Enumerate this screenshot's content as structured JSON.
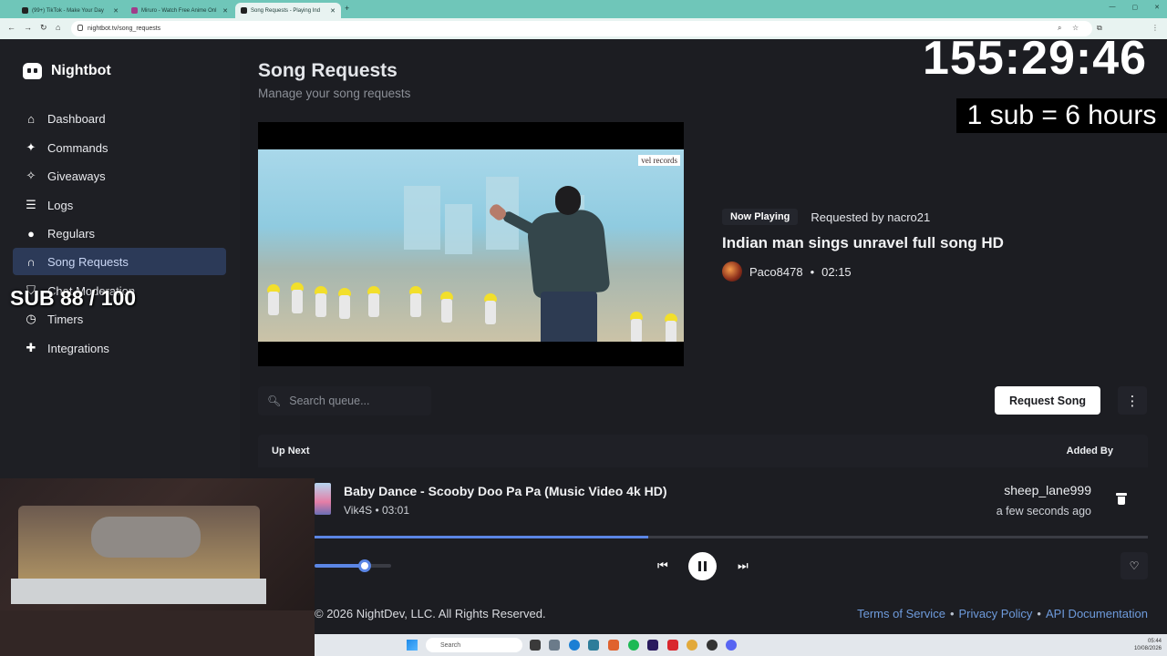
{
  "browser": {
    "tabs": [
      {
        "label": "(99+) TikTok - Make Your Day",
        "active": false
      },
      {
        "label": "Miruro - Watch Free Anime Onl",
        "active": false
      },
      {
        "label": "Song Requests - Playing Ind",
        "active": true
      }
    ],
    "url": "nightbot.tv/song_requests"
  },
  "sidebar": {
    "brand": "Nightbot",
    "items": [
      {
        "label": "Dashboard",
        "icon": "home-icon"
      },
      {
        "label": "Commands",
        "icon": "wand-icon"
      },
      {
        "label": "Giveaways",
        "icon": "party-icon"
      },
      {
        "label": "Logs",
        "icon": "list-icon"
      },
      {
        "label": "Regulars",
        "icon": "users-icon"
      },
      {
        "label": "Song Requests",
        "icon": "headphones-icon",
        "active": true
      },
      {
        "label": "Chat Moderation",
        "icon": "shield-icon"
      },
      {
        "label": "Timers",
        "icon": "clock-icon"
      },
      {
        "label": "Integrations",
        "icon": "puzzle-icon"
      }
    ]
  },
  "main": {
    "title": "Song Requests",
    "subtitle": "Manage your song requests",
    "video_watermark": "vel records",
    "now_playing": {
      "badge": "Now Playing",
      "requested_by": "Requested by nacro21",
      "title": "Indian man sings unravel full song HD",
      "channel": "Paco8478",
      "separator": "•",
      "duration": "02:15"
    },
    "search": {
      "placeholder": "Search queue..."
    },
    "request_button": "Request Song",
    "queue": {
      "header_left": "Up Next",
      "header_right": "Added By",
      "items": [
        {
          "title": "Baby Dance - Scooby Doo Pa Pa (Music Video 4k HD)",
          "meta": "Vik4S • 03:01",
          "added_by": "sheep_lane999",
          "added_time": "a few seconds ago"
        }
      ]
    },
    "player": {
      "progress": 0.4,
      "volume": 0.65
    },
    "footer": {
      "copyright": "© 2026 NightDev, LLC. All Rights Reserved.",
      "links": [
        "Terms of Service",
        "Privacy Policy",
        "API Documentation"
      ],
      "link_separator": "•"
    }
  },
  "overlays": {
    "timer": "155:29:46",
    "sub_rate": "1 sub = 6 hours",
    "sub_count": "SUB 88 / 100"
  },
  "taskbar": {
    "search": "Search",
    "time": "05:44",
    "date": "10/08/2026"
  },
  "colors": {
    "accent": "#5b86e5",
    "sidebar_active": "#2c3a58",
    "background": "#1c1d22",
    "link": "#6e9bdc"
  }
}
